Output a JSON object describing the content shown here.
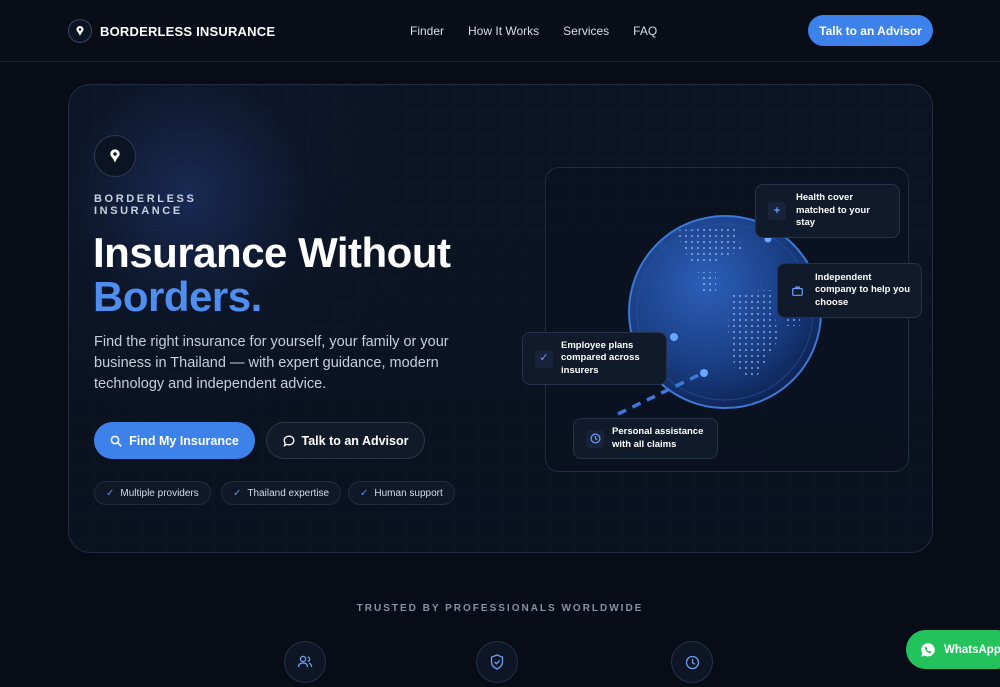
{
  "nav": {
    "brand": "BORDERLESS INSURANCE",
    "links": [
      "Finder",
      "How It Works",
      "Services",
      "FAQ"
    ],
    "cta": "Talk to an Advisor"
  },
  "hero": {
    "eyebrow": "BORDERLESS INSURANCE",
    "headline_line1": "Insurance Without",
    "headline_line2": "Borders",
    "headline_dot": ".",
    "subcopy": "Find the right insurance for yourself, your family or your business in Thailand — with expert guidance, modern technology and independent advice.",
    "primary_button": "Find My Insurance",
    "secondary_button": "Talk to an Advisor",
    "chips": [
      "Multiple providers",
      "Thailand expertise",
      "Human support"
    ]
  },
  "globe_cards": {
    "health": "Health cover matched to your stay",
    "independent": "Independent company to help you choose",
    "employee": "Employee plans compared across insurers",
    "personal": "Personal assistance with all claims"
  },
  "trusted": {
    "heading": "TRUSTED BY PROFESSIONALS WORLDWIDE",
    "icons": [
      "users-icon",
      "shield-check-icon",
      "clock-icon"
    ]
  },
  "whatsapp": {
    "label": "WhatsApp"
  },
  "colors": {
    "accent": "#3d82ea",
    "background": "#070c16",
    "whatsapp": "#23c25c"
  }
}
